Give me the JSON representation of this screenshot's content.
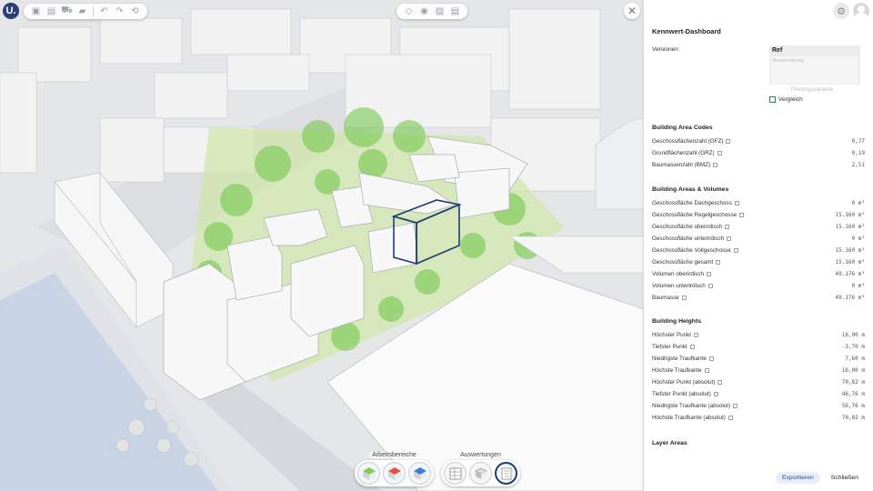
{
  "app": {
    "logo_letter": "U."
  },
  "viewport": {
    "bottom_groups": [
      {
        "label": "Arbeitsbereiche"
      },
      {
        "label": "Auswertungen"
      }
    ]
  },
  "panel": {
    "title": "Kennwert-Dashboard",
    "versions_label": "Versionen",
    "version_selected": "Ref",
    "description_placeholder": "Beschreibung",
    "planning_variant": "Planungsvariante",
    "compare_label": "Vergleich",
    "sections": {
      "area_codes": {
        "title": "Building Area Codes",
        "rows": [
          {
            "label": "Geschossflächenzahl (GFZ)",
            "value": "0,77"
          },
          {
            "label": "Grundflächenzahl (GRZ)",
            "value": "0,19"
          },
          {
            "label": "Baumassenzahl (BMZ)",
            "value": "2,51"
          }
        ]
      },
      "areas_volumes": {
        "title": "Building Areas & Volumes",
        "rows": [
          {
            "label": "Geschossfläche Dachgeschoss",
            "value": "0 m²"
          },
          {
            "label": "Geschossfläche Regelgeschosse",
            "value": "15.160 m²"
          },
          {
            "label": "Geschossfläche oberirdisch",
            "value": "15.160 m²"
          },
          {
            "label": "Geschossfläche unterirdisch",
            "value": "0 m²"
          },
          {
            "label": "Geschossfläche Vollgeschosse",
            "value": "15.160 m²"
          },
          {
            "label": "Geschossfläche gesamt",
            "value": "15.160 m²"
          },
          {
            "label": "Volumen oberirdisch",
            "value": "49.176 m³"
          },
          {
            "label": "Volumen unterirdisch",
            "value": "0 m³"
          },
          {
            "label": "Baumasse",
            "value": "49.176 m³"
          }
        ]
      },
      "heights": {
        "title": "Building Heights",
        "rows": [
          {
            "label": "Höchster Punkt",
            "value": "16,00 m"
          },
          {
            "label": "Tiefster Punkt",
            "value": "-3,70 m"
          },
          {
            "label": "Niedrigste Traufkante",
            "value": "7,60 m"
          },
          {
            "label": "Höchste Traufkante",
            "value": "16,00 m"
          },
          {
            "label": "Höchster Punkt (absolut)",
            "value": "70,82 m"
          },
          {
            "label": "Tiefster Punkt (absolut)",
            "value": "46,76 m"
          },
          {
            "label": "Niedrigste Traufkante (absolut)",
            "value": "56,76 m"
          },
          {
            "label": "Höchste Traufkante (absolut)",
            "value": "70,82 m"
          }
        ]
      },
      "layer_areas": {
        "title": "Layer Areas"
      }
    },
    "footer": {
      "export_label": "Exportieren",
      "close_label": "Schließen"
    }
  },
  "colors": {
    "accent": "#1f4a8c",
    "logo_bg": "#2a3f73",
    "vegetation": "#7ccf5a",
    "selection": "#1e3c72"
  }
}
